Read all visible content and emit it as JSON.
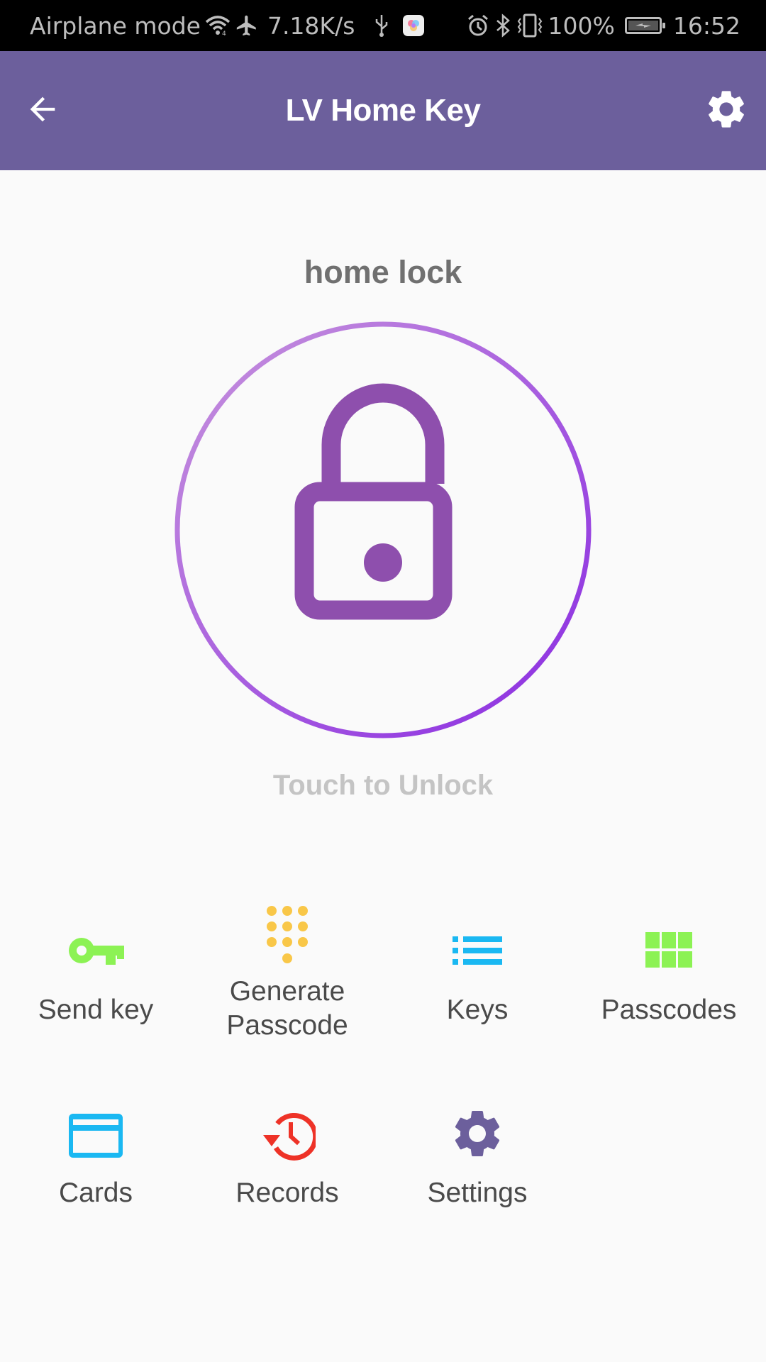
{
  "status_bar": {
    "network_label": "Airplane mode",
    "speed": "7.18K/s",
    "battery": "100%",
    "time": "16:52",
    "icons": [
      "wifi-icon",
      "airplane-icon",
      "usb-icon",
      "app-notification-icon",
      "alarm-icon",
      "bluetooth-icon",
      "vibrate-icon",
      "battery-charging-icon"
    ]
  },
  "app_bar": {
    "title": "LV Home Key",
    "back_icon": "arrow-left-icon",
    "settings_icon": "gear-icon"
  },
  "lock": {
    "name": "home lock",
    "icon": "lock-icon",
    "hint": "Touch to Unlock",
    "ring_colors": [
      "#c794dc",
      "#8a2be2"
    ],
    "lock_color": "#8e4fad"
  },
  "menu": {
    "items": [
      {
        "label": "Send key",
        "icon": "key-icon",
        "color": "#8cf254"
      },
      {
        "label_line1": "Generate",
        "label_line2": "Passcode",
        "icon": "dialpad-icon",
        "color": "#f9c748"
      },
      {
        "label": "Keys",
        "icon": "list-icon",
        "color": "#1ab8f2"
      },
      {
        "label": "Passcodes",
        "icon": "grid-icon",
        "color": "#8cf254"
      },
      {
        "label": "Cards",
        "icon": "card-icon",
        "color": "#1ab8f2"
      },
      {
        "label": "Records",
        "icon": "history-icon",
        "color": "#ee3227"
      },
      {
        "label": "Settings",
        "icon": "gear-icon",
        "color": "#6c5f9c"
      }
    ]
  }
}
